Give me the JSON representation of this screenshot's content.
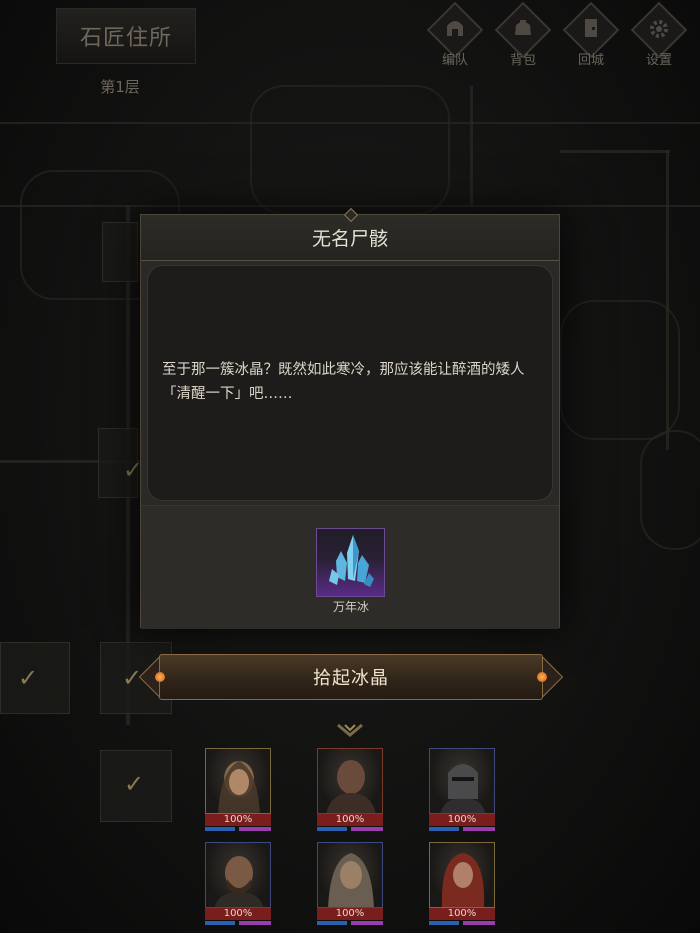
{
  "hud": {
    "location": "石匠住所",
    "floor": "第1层",
    "buttons": [
      {
        "label": "编队",
        "icon": "helmet-icon"
      },
      {
        "label": "背包",
        "icon": "bag-icon"
      },
      {
        "label": "回城",
        "icon": "door-icon"
      },
      {
        "label": "设置",
        "icon": "gear-icon"
      }
    ]
  },
  "dialog": {
    "title": "无名尸骸",
    "text": "至于那一簇冰晶？既然如此寒冷，那应该能让醉酒的矮人「清醒一下」吧……",
    "reward": {
      "name": "万年冰",
      "icon": "ice-crystal-icon"
    }
  },
  "action": {
    "label": "拾起冰晶"
  },
  "team": [
    {
      "hp": "100%",
      "icon": "hooded-woman-portrait"
    },
    {
      "hp": "100%",
      "icon": "bald-man-portrait"
    },
    {
      "hp": "100%",
      "icon": "knight-helmet-portrait"
    },
    {
      "hp": "100%",
      "icon": "bearded-man-portrait"
    },
    {
      "hp": "100%",
      "icon": "hooded-elder-portrait"
    },
    {
      "hp": "100%",
      "icon": "red-haired-woman-portrait"
    }
  ],
  "colors": {
    "accent": "#8a6c44",
    "hp": "#7a1d1d",
    "mana": "#2d5fb0",
    "rare": "#5a2b86"
  }
}
